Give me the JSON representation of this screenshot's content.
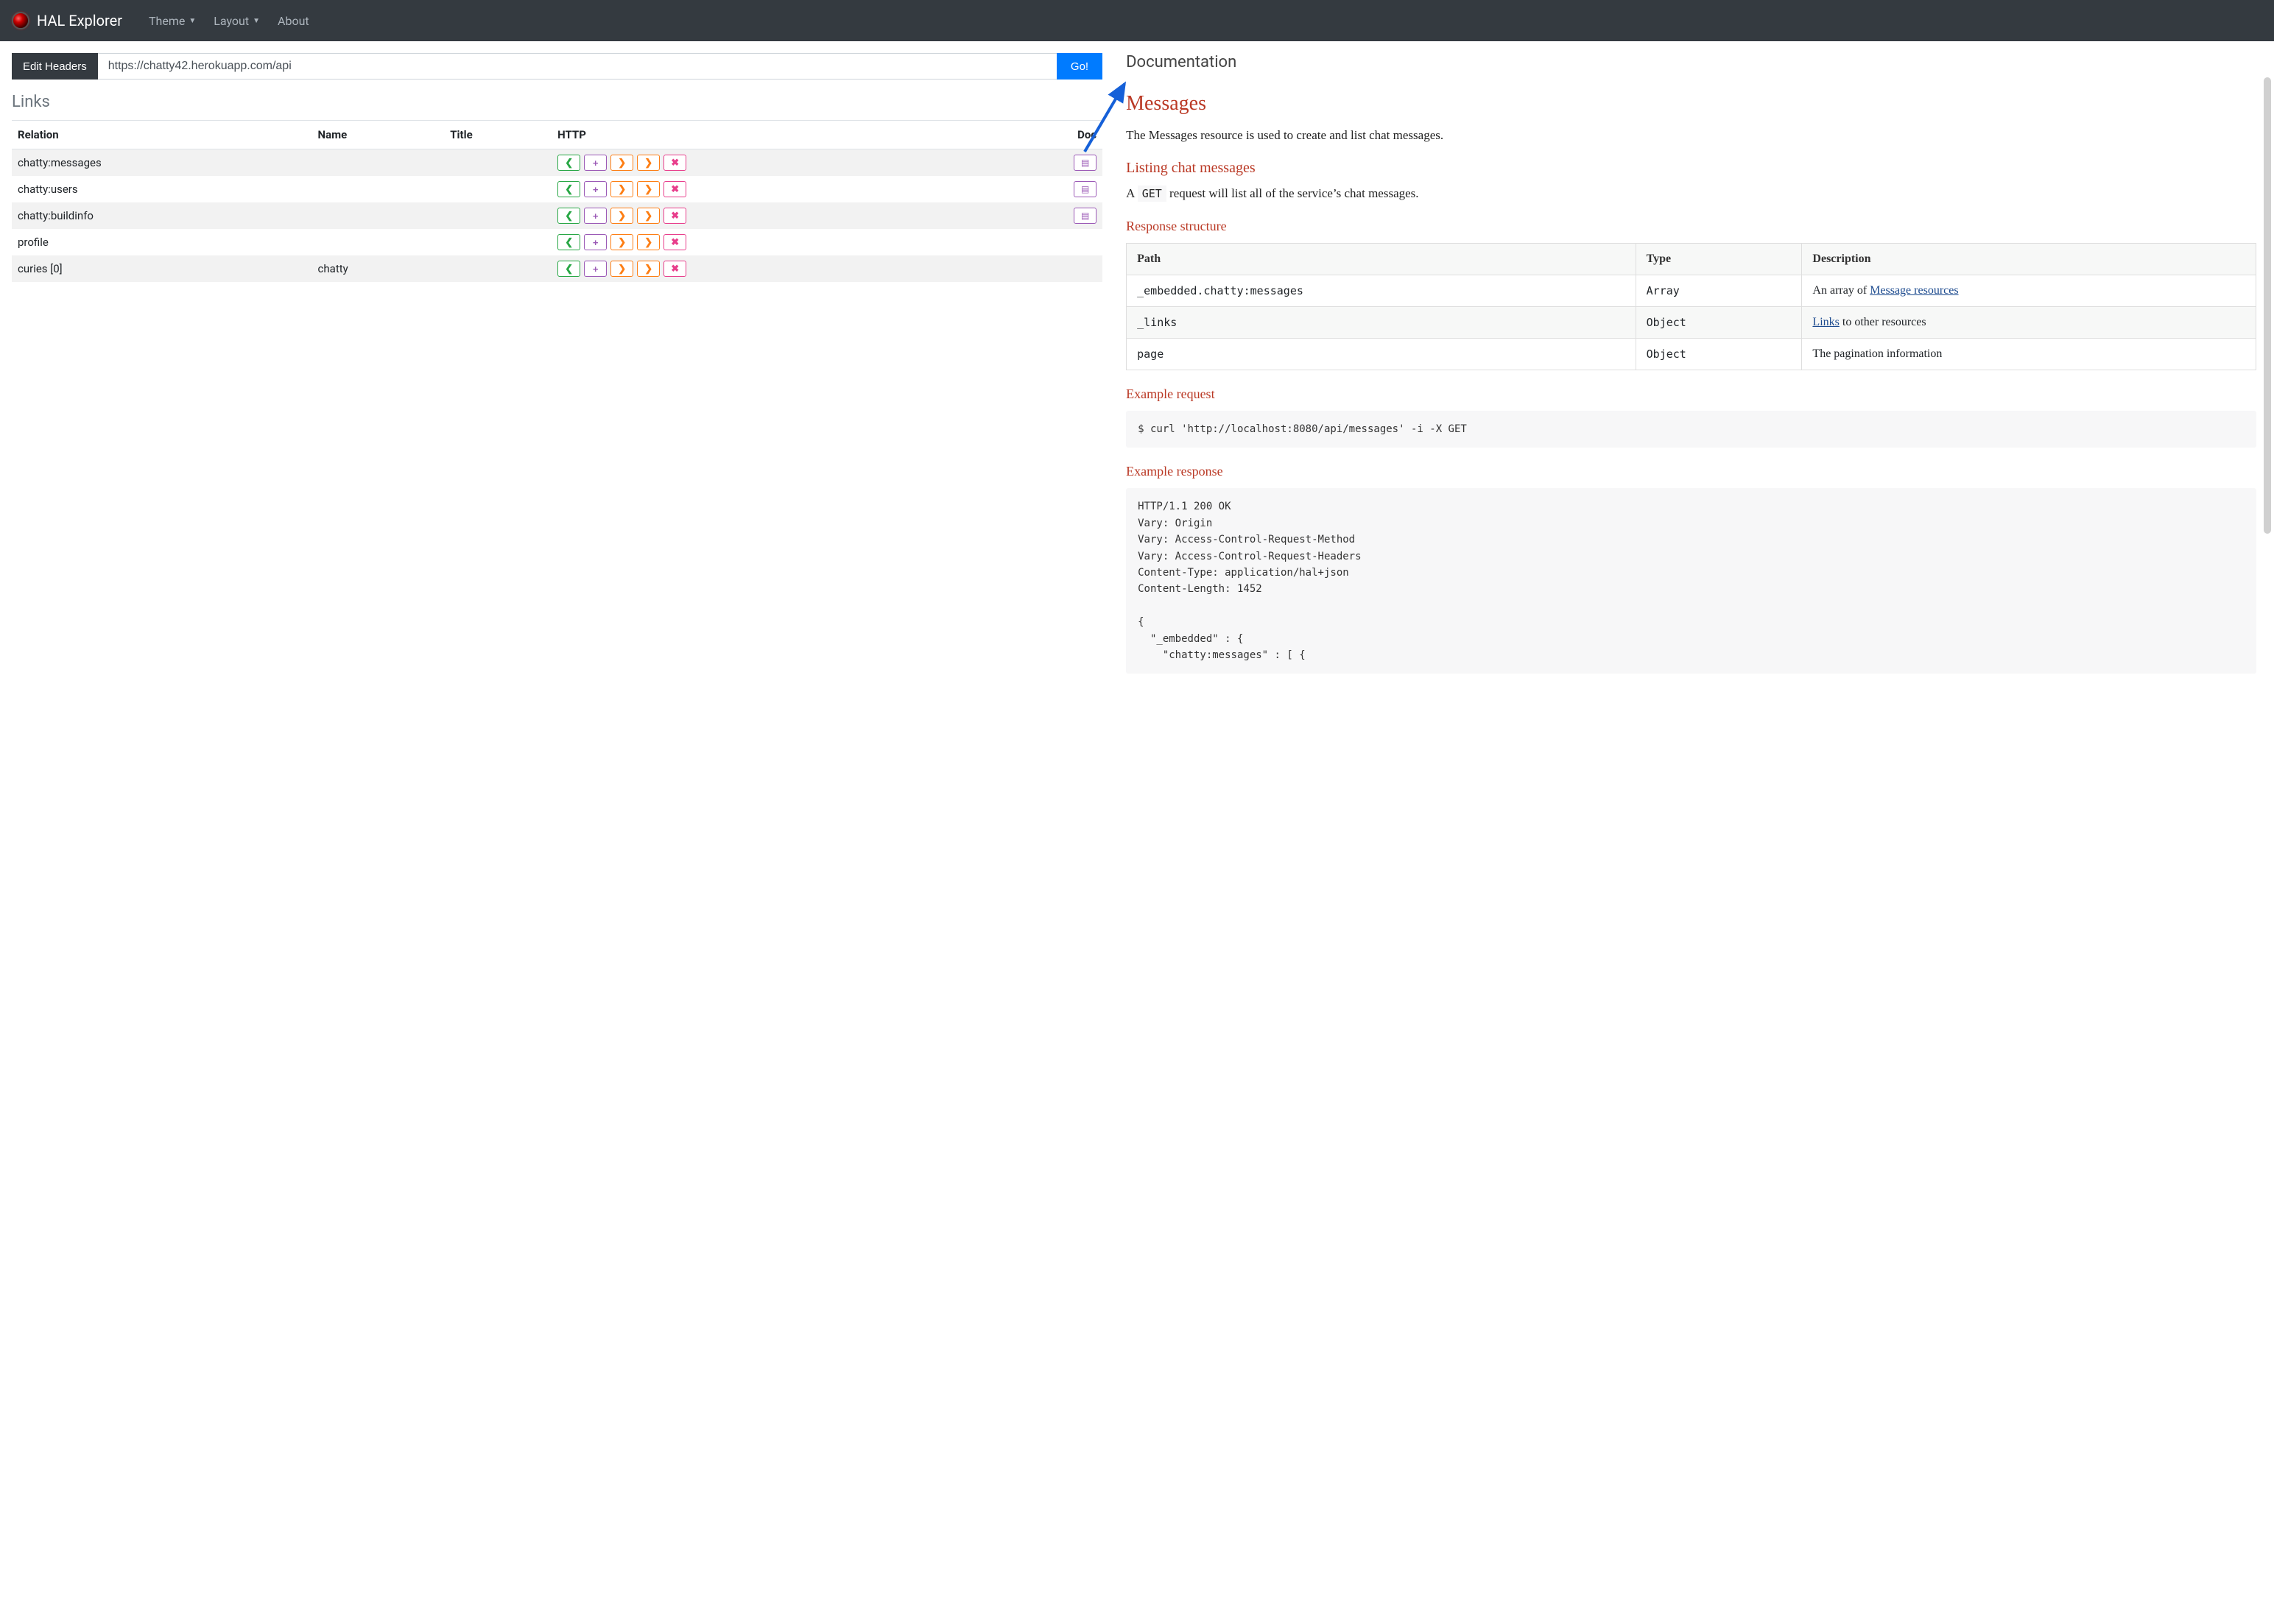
{
  "navbar": {
    "brand": "HAL Explorer",
    "items": [
      "Theme",
      "Layout",
      "About"
    ]
  },
  "urlbar": {
    "edit_headers": "Edit Headers",
    "url": "https://chatty42.herokuapp.com/api",
    "go": "Go!"
  },
  "links_section": {
    "title": "Links",
    "columns": [
      "Relation",
      "Name",
      "Title",
      "HTTP",
      "Doc"
    ],
    "rows": [
      {
        "relation": "chatty:messages",
        "name": "",
        "title": "",
        "has_doc": true
      },
      {
        "relation": "chatty:users",
        "name": "",
        "title": "",
        "has_doc": true
      },
      {
        "relation": "chatty:buildinfo",
        "name": "",
        "title": "",
        "has_doc": true
      },
      {
        "relation": "profile",
        "name": "",
        "title": "",
        "has_doc": false
      },
      {
        "relation": "curies [0]",
        "name": "chatty",
        "title": "",
        "has_doc": false
      }
    ]
  },
  "documentation": {
    "heading": "Documentation",
    "h1": "Messages",
    "intro": "The Messages resource is used to create and list chat messages.",
    "listing_h2": "Listing chat messages",
    "listing_text_pre": "A ",
    "listing_code": "GET",
    "listing_text_post": " request will list all of the service’s chat messages.",
    "response_h3": "Response structure",
    "table": {
      "headers": [
        "Path",
        "Type",
        "Description"
      ],
      "rows": [
        {
          "path": "_embedded.chatty:messages",
          "type": "Array",
          "desc_pre": "An array of ",
          "link": "Message resources",
          "desc_post": ""
        },
        {
          "path": "_links",
          "type": "Object",
          "desc_pre": "",
          "link": "Links",
          "desc_post": " to other resources"
        },
        {
          "path": "page",
          "type": "Object",
          "desc_pre": "The pagination information",
          "link": "",
          "desc_post": ""
        }
      ]
    },
    "example_request_h3": "Example request",
    "example_request_code": "$ curl 'http://localhost:8080/api/messages' -i -X GET",
    "example_response_h3": "Example response",
    "example_response_code": "HTTP/1.1 200 OK\nVary: Origin\nVary: Access-Control-Request-Method\nVary: Access-Control-Request-Headers\nContent-Type: application/hal+json\nContent-Length: 1452\n\n{\n  \"_embedded\" : {\n    \"chatty:messages\" : [ {"
  }
}
